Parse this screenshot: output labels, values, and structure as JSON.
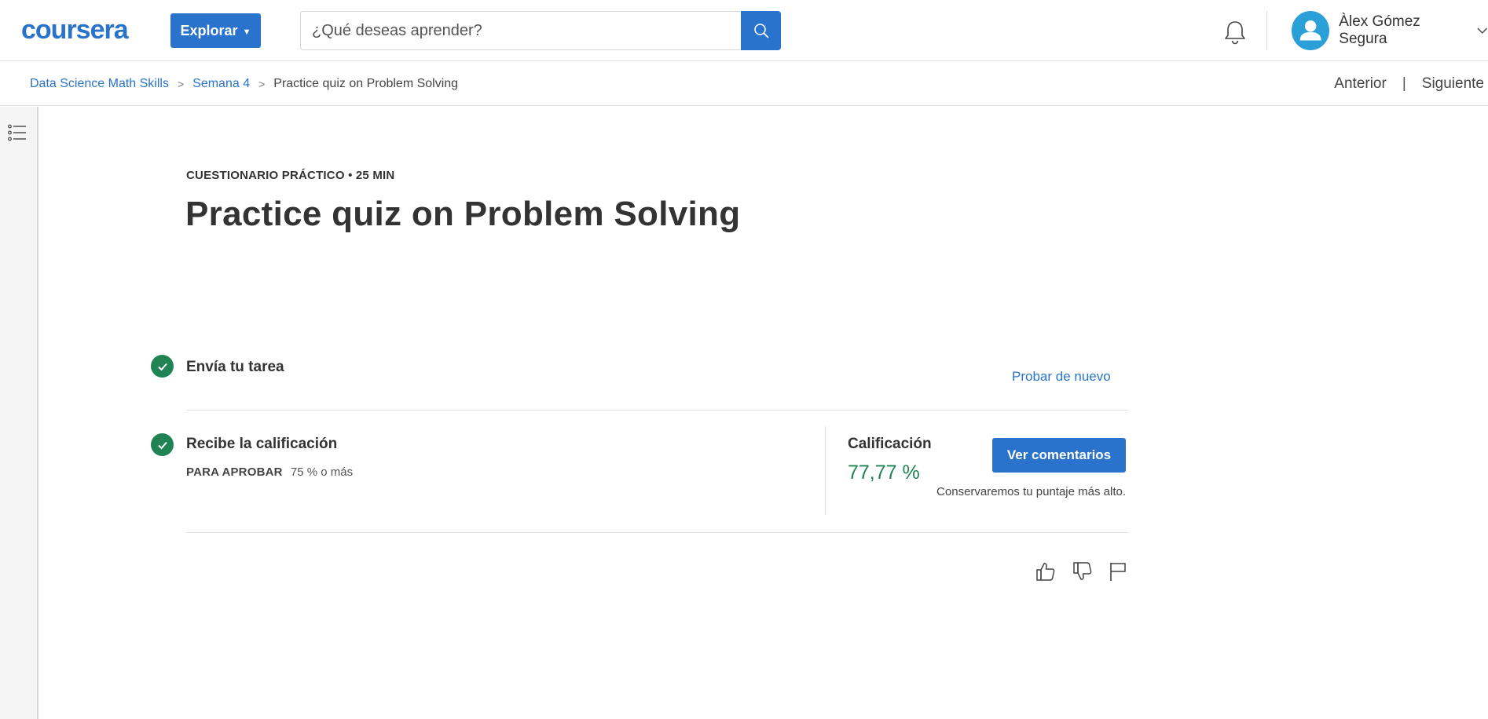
{
  "header": {
    "logo_text": "coursera",
    "explore_label": "Explorar",
    "search": {
      "placeholder": "¿Qué deseas aprender?",
      "value": ""
    },
    "user_name": "Àlex Gómez Segura"
  },
  "breadcrumb": {
    "items": [
      "Data Science Math Skills",
      "Semana 4",
      "Practice quiz on Problem Solving"
    ],
    "separator": ">"
  },
  "nav": {
    "previous": "Anterior",
    "separator": "|",
    "next": "Siguiente"
  },
  "content": {
    "meta": "CUESTIONARIO PRÁCTICO • 25 MIN",
    "title": "Practice quiz on Problem Solving",
    "step1": {
      "title": "Envía tu tarea",
      "action": "Probar de nuevo"
    },
    "step2": {
      "title": "Recibe la calificación",
      "pass_label": "PARA APROBAR",
      "pass_value": "75 % o más"
    },
    "grade": {
      "label": "Calificación",
      "value": "77,77 %",
      "button": "Ver comentarios",
      "note": "Conservaremos tu puntaje más alto."
    }
  },
  "colors": {
    "brand_blue": "#2a73cc",
    "success_green": "#1f8354",
    "avatar_blue": "#2a9fd8"
  },
  "icons": [
    "search-icon",
    "bell-icon",
    "user-icon",
    "chevron-down-icon",
    "list-menu-icon",
    "check-icon",
    "thumbs-up-icon",
    "thumbs-down-icon",
    "flag-icon"
  ]
}
